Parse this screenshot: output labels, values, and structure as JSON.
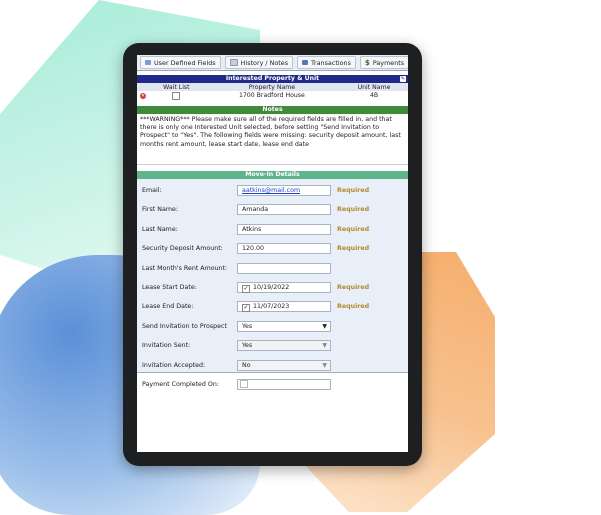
{
  "tabs": [
    {
      "label": "User Defined Fields",
      "icon": "fields-icon"
    },
    {
      "label": "History / Notes",
      "icon": "history-icon"
    },
    {
      "label": "Transactions",
      "icon": "transactions-icon"
    },
    {
      "label": "Payments",
      "icon": "dollar-icon"
    }
  ],
  "interested": {
    "title": "Interested Property & Unit",
    "columns": [
      "Wait List",
      "Property Name",
      "Unit Name"
    ],
    "rows": [
      {
        "wait_list": false,
        "property": "1700 Bradford House",
        "unit": "4B"
      }
    ]
  },
  "notes": {
    "title": "Notes",
    "text": "***WARNING*** Please make sure all of the required fields are filled in, and that there is only one Interested Unit selected, before setting \"Send Invitation to Prospect\" to \"Yes\". The following fields were missing: security deposit amount, last months rent amount, lease start date, lease end date"
  },
  "movein": {
    "title": "Move-In Details",
    "required_label": "Required",
    "fields": {
      "email": {
        "label": "Email:",
        "value": "aatkins@mail.com"
      },
      "first_name": {
        "label": "First Name:",
        "value": "Amanda"
      },
      "last_name": {
        "label": "Last Name:",
        "value": "Atkins"
      },
      "deposit": {
        "label": "Security Deposit Amount:",
        "value": "120.00"
      },
      "last_rent": {
        "label": "Last Month's Rent Amount:",
        "value": ""
      },
      "lease_start": {
        "label": "Lease Start Date:",
        "value": "10/19/2022",
        "checked": true
      },
      "lease_end": {
        "label": "Lease End Date:",
        "value": "11/07/2023",
        "checked": true
      },
      "send_invite": {
        "label": "Send Invitation to Prospect",
        "value": "Yes"
      },
      "invite_sent": {
        "label": "Invitation Sent:",
        "value": "Yes"
      },
      "invite_accepted": {
        "label": "Invitation Accepted:",
        "value": "No"
      },
      "payment_completed": {
        "label": "Payment Completed On:",
        "value": ""
      }
    }
  },
  "colors": {
    "navy_header": "#1f2a8a",
    "notes_header": "#3f8a3b",
    "movein_header": "#5fb58b",
    "required_text": "#b4892e",
    "link_text": "#1a3fd1"
  }
}
